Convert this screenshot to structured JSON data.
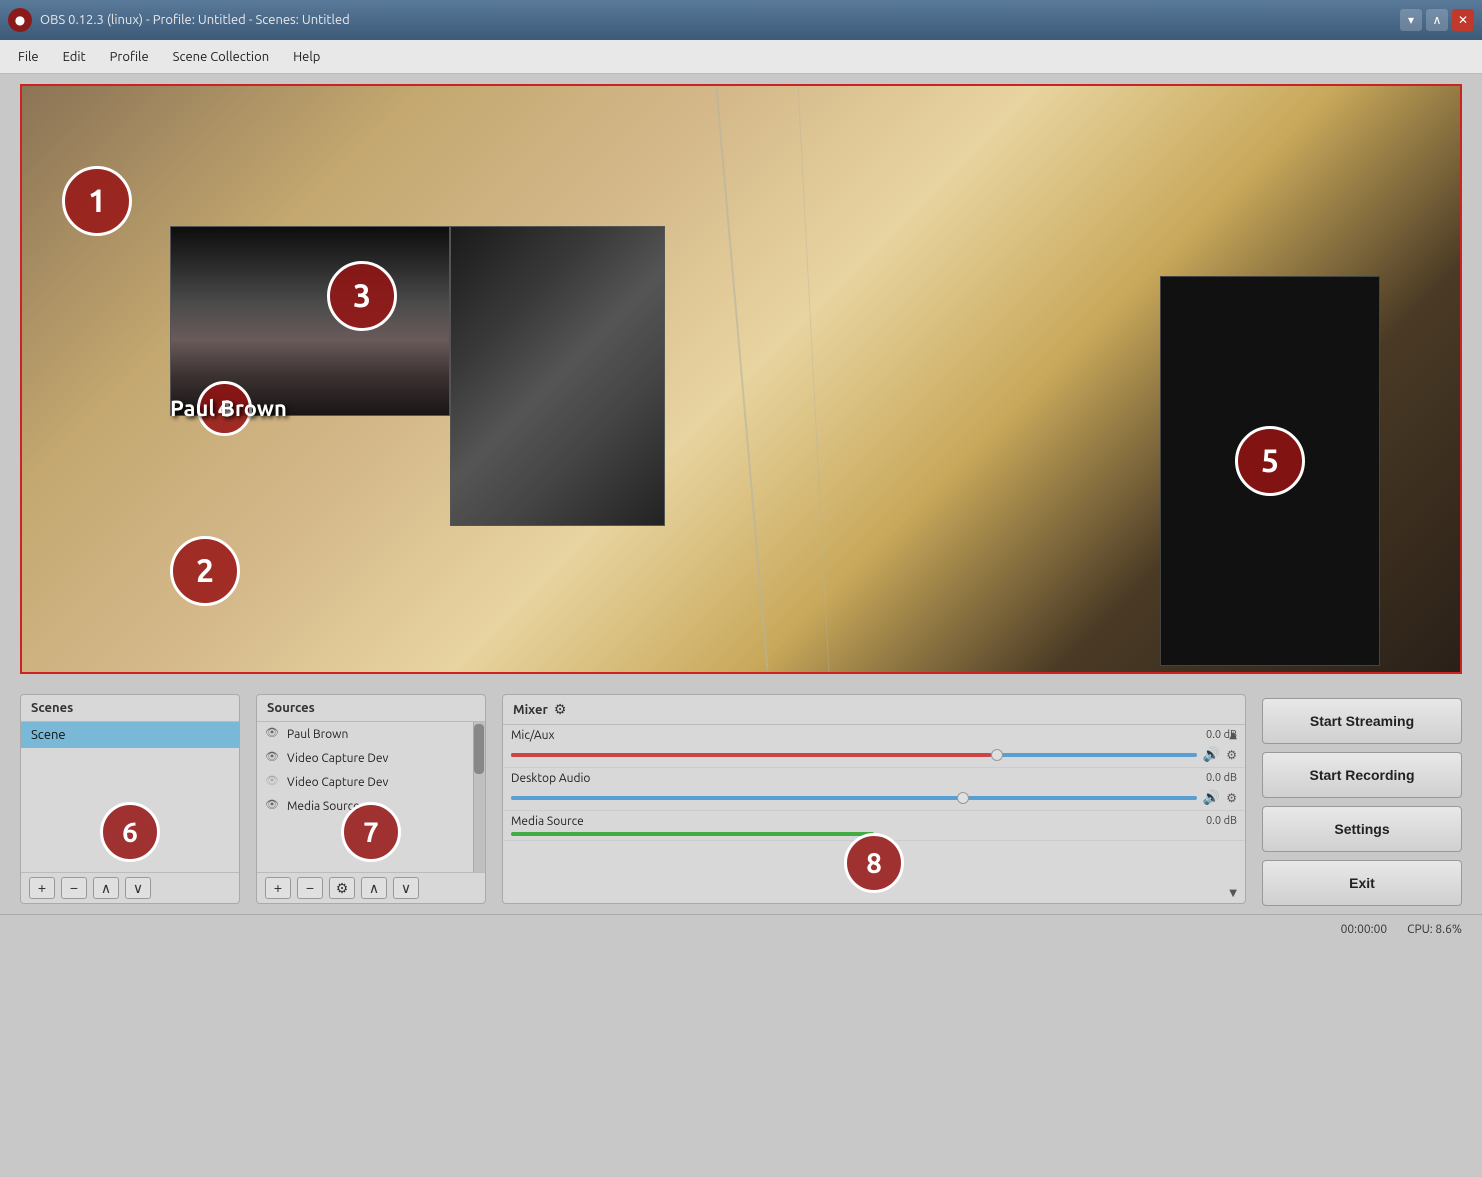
{
  "window": {
    "title": "OBS 0.12.3 (linux) - Profile: Untitled - Scenes: Untitled",
    "app_icon": "●",
    "wm_buttons": [
      "▾",
      "∧",
      "✕"
    ]
  },
  "menu": {
    "items": [
      "File",
      "Edit",
      "Profile",
      "Scene Collection",
      "Help"
    ]
  },
  "preview": {
    "numbers": [
      "1",
      "2",
      "3",
      "4",
      "5"
    ],
    "lower_third": "Paul Brown"
  },
  "scenes": {
    "header": "Scenes",
    "items": [
      {
        "label": "Scene",
        "selected": true
      }
    ],
    "footer_buttons": [
      "+",
      "−",
      "∧",
      "∨"
    ]
  },
  "sources": {
    "header": "Sources",
    "items": [
      {
        "label": "Paul Brown",
        "visible": true
      },
      {
        "label": "Video Capture Dev",
        "visible": true
      },
      {
        "label": "Video Capture Dev",
        "visible": false
      },
      {
        "label": "Media Source",
        "visible": true
      }
    ],
    "footer_buttons": [
      "+",
      "−",
      "⚙",
      "∧",
      "∨"
    ]
  },
  "mixer": {
    "header": "Mixer",
    "gear_icon": "⚙",
    "tracks": [
      {
        "name": "Mic/Aux",
        "db": "0.0 dB",
        "level": 70,
        "has_volume": true,
        "has_gear": true,
        "bar_color": "red"
      },
      {
        "name": "Desktop Audio",
        "db": "0.0 dB",
        "level": 65,
        "has_volume": true,
        "has_gear": true,
        "bar_color": "blue"
      },
      {
        "name": "Media Source",
        "db": "0.0 dB",
        "level": 50,
        "has_volume": false,
        "has_gear": false,
        "bar_color": "green"
      }
    ],
    "scroll_buttons": [
      "∧",
      "∨"
    ]
  },
  "controls": {
    "start_streaming": "Start Streaming",
    "start_recording": "Start Recording",
    "settings": "Settings",
    "exit": "Exit"
  },
  "status_bar": {
    "time": "00:00:00",
    "cpu": "CPU: 8.6%"
  },
  "panel_numbers": {
    "scenes": "6",
    "sources": "7",
    "mixer": "8"
  }
}
